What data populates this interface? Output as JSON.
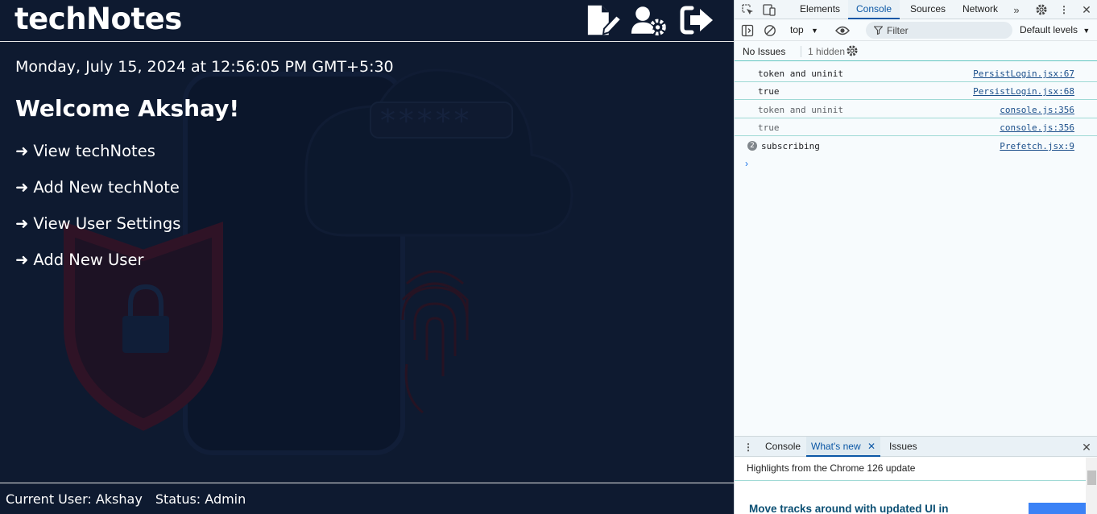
{
  "app": {
    "title": "techNotes",
    "header_buttons": [
      {
        "name": "new-note-icon",
        "label": "New Note"
      },
      {
        "name": "user-settings-icon",
        "label": "User Settings"
      },
      {
        "name": "logout-icon",
        "label": "Logout"
      }
    ],
    "date": "Monday, July 15, 2024 at 12:56:05 PM GMT+5:30",
    "welcome": "Welcome Akshay!",
    "arrow": "➜",
    "links": [
      "View techNotes",
      "Add New techNote",
      "View User Settings",
      "Add New User"
    ],
    "footer": {
      "current_user": "Current User: Akshay",
      "status": "Status: Admin"
    }
  },
  "devtools": {
    "tabs": [
      "Elements",
      "Console",
      "Sources",
      "Network"
    ],
    "active_tab": "Console",
    "context": "top",
    "filter_placeholder": "Filter",
    "levels": "Default levels",
    "no_issues": "No Issues",
    "hidden": "1 hidden",
    "logs": [
      {
        "msg": "token and uninit",
        "src": "PersistLogin.jsx:67"
      },
      {
        "msg": "true",
        "src": "PersistLogin.jsx:68"
      },
      {
        "msg": "token and uninit",
        "src": "console.js:356"
      },
      {
        "msg": "true",
        "src": "console.js:356"
      },
      {
        "msg": "subscribing",
        "src": "Prefetch.jsx:9",
        "count": "2"
      }
    ],
    "drawer": {
      "tabs": [
        "Console",
        "What's new",
        "Issues"
      ],
      "active": "What's new",
      "highlights": "Highlights from the Chrome 126 update",
      "news_title": "Move tracks around with updated UI in"
    }
  },
  "colors": {
    "app_bg": "#0e1a30",
    "devtools_accent": "#0b57a5",
    "console_link": "#1a4e8a"
  }
}
